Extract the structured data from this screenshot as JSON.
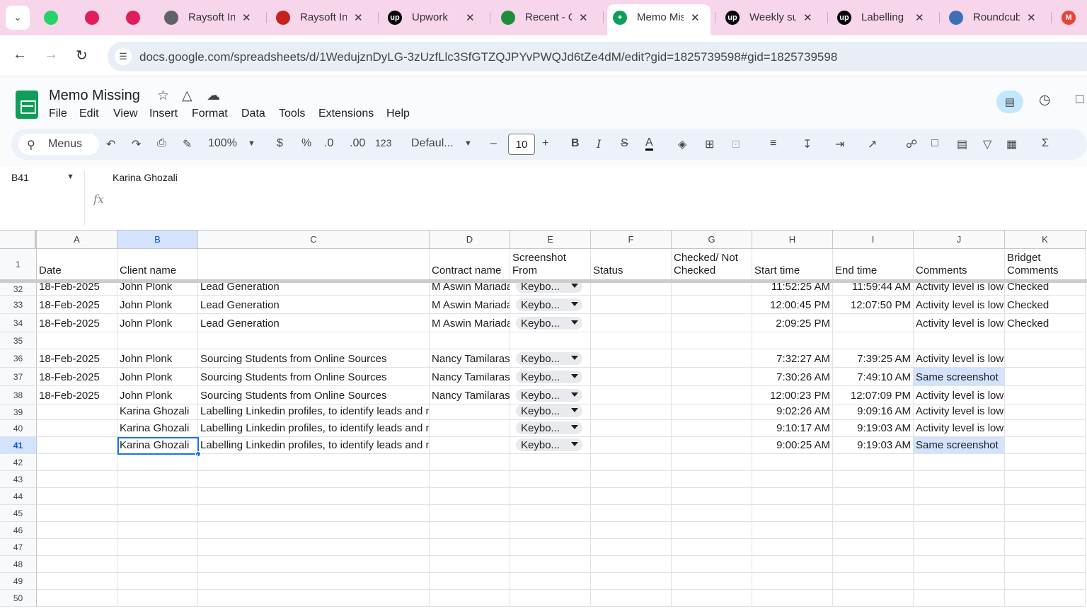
{
  "browser": {
    "tabs": [
      {
        "label": "",
        "icon": "whatsapp-icon",
        "color": "#25d366"
      },
      {
        "label": "",
        "icon": "slack-icon",
        "color": "#e01e5a"
      },
      {
        "label": "",
        "icon": "slack-icon",
        "color": "#e01e5a"
      },
      {
        "label": "Raysoft Inf",
        "icon": "globe-icon",
        "color": "#5f6368"
      },
      {
        "label": "Raysoft Inf",
        "icon": "raysoft-icon",
        "color": "#c5221f"
      },
      {
        "label": "Upwork",
        "icon": "upwork-icon",
        "color": "#000000"
      },
      {
        "label": "Recent - G",
        "icon": "drive-icon",
        "color": "#1e8e3e"
      },
      {
        "label": "Memo Mis",
        "icon": "sheets-icon",
        "color": "#0f9d58"
      },
      {
        "label": "Weekly su",
        "icon": "upwork-icon",
        "color": "#000000"
      },
      {
        "label": "Labelling",
        "icon": "upwork-icon",
        "color": "#000000"
      },
      {
        "label": "Roundcub",
        "icon": "roundcube-icon",
        "color": "#3c6fb6"
      },
      {
        "label": "",
        "icon": "gmail-icon",
        "color": "#ea4335"
      }
    ],
    "url": "docs.google.com/spreadsheets/d/1WedujznDyLG-3zUzfLlc3SfGTZQJPYvPWQJd6tZe4dM/edit?gid=1825739598#gid=1825739598"
  },
  "doc": {
    "title": "Memo Missing",
    "menu": [
      "File",
      "Edit",
      "View",
      "Insert",
      "Format",
      "Data",
      "Tools",
      "Extensions",
      "Help"
    ]
  },
  "toolbar": {
    "menus_label": "Menus",
    "zoom": "100%",
    "currency": "$",
    "percent": "%",
    "dec_decrease": ".0",
    "dec_increase": ".00",
    "number_format": "123",
    "font": "Defaul...",
    "font_size": "10"
  },
  "formula_bar": {
    "name_box": "B41",
    "fx": "fx",
    "value": "Karina Ghozali"
  },
  "sheet": {
    "columns": [
      "A",
      "B",
      "C",
      "D",
      "E",
      "F",
      "G",
      "H",
      "I",
      "J",
      "K"
    ],
    "selected_column": "B",
    "header_row": {
      "num": "1",
      "cells": [
        "Date",
        "Client name",
        "",
        "Contract name",
        "Screenshot From",
        "Status",
        "Checked/ Not Checked",
        "Start time",
        "End time",
        "Comments",
        "Bridget Comments"
      ]
    },
    "rows": [
      {
        "num": "32",
        "date": "18-Feb-2025",
        "client": "John Plonk",
        "contract": "Lead Generation",
        "freelancer": "M Aswin Mariadass",
        "chip": "Keybo...",
        "start": "11:52:25 AM",
        "end": "11:59:44 AM",
        "comment": "Activity level is low",
        "bridget": "Checked",
        "hl": false
      },
      {
        "num": "33",
        "date": "18-Feb-2025",
        "client": "John Plonk",
        "contract": "Lead Generation",
        "freelancer": "M Aswin Mariadass",
        "chip": "Keybo...",
        "start": "12:00:45 PM",
        "end": "12:07:50 PM",
        "comment": "Activity level is low",
        "bridget": "Checked",
        "hl": false
      },
      {
        "num": "34",
        "date": "18-Feb-2025",
        "client": "John Plonk",
        "contract": "Lead Generation",
        "freelancer": "M Aswin Mariadass",
        "chip": "Keybo...",
        "start": "2:09:25 PM",
        "end": "",
        "comment": "Activity level is low",
        "bridget": "Checked",
        "hl": false
      },
      {
        "num": "35",
        "date": "",
        "client": "",
        "contract": "",
        "freelancer": "",
        "chip": "",
        "start": "",
        "end": "",
        "comment": "",
        "bridget": "",
        "hl": false
      },
      {
        "num": "36",
        "date": "18-Feb-2025",
        "client": "John Plonk",
        "contract": "Sourcing Students from Online Sources",
        "freelancer": "Nancy Tamilarasi",
        "chip": "Keybo...",
        "start": "7:32:27 AM",
        "end": "7:39:25 AM",
        "comment": "Activity level is low",
        "bridget": "",
        "hl": false
      },
      {
        "num": "37",
        "date": "18-Feb-2025",
        "client": "John Plonk",
        "contract": "Sourcing Students from Online Sources",
        "freelancer": "Nancy Tamilarasi",
        "chip": "Keybo...",
        "start": "7:30:26 AM",
        "end": "7:49:10 AM",
        "comment": "Same screenshot",
        "bridget": "",
        "hl": true
      },
      {
        "num": "38",
        "date": "18-Feb-2025",
        "client": "John Plonk",
        "contract": "Sourcing Students from Online Sources",
        "freelancer": "Nancy Tamilarasi",
        "chip": "Keybo...",
        "start": "12:00:23 PM",
        "end": "12:07:09 PM",
        "comment": "Activity level is low",
        "bridget": "",
        "hl": false
      },
      {
        "num": "39",
        "date": "",
        "client": "Karina Ghozali",
        "contract": "Labelling Linkedin profiles, to identify leads and nurture an artificial",
        "freelancer": "",
        "chip": "Keybo...",
        "start": "9:02:26 AM",
        "end": "9:09:16 AM",
        "comment": "Activity level is low",
        "bridget": "",
        "hl": false
      },
      {
        "num": "40",
        "date": "",
        "client": "Karina Ghozali",
        "contract": "Labelling Linkedin profiles, to identify leads and nurture an artificial",
        "freelancer": "",
        "chip": "Keybo...",
        "start": "9:10:17 AM",
        "end": "9:19:03 AM",
        "comment": "Activity level is low",
        "bridget": "",
        "hl": false
      },
      {
        "num": "41",
        "date": "",
        "client": "Karina Ghozali",
        "contract": "Labelling Linkedin profiles, to identify leads and nurture an artificial",
        "freelancer": "",
        "chip": "Keybo...",
        "start": "9:00:25 AM",
        "end": "9:19:03 AM",
        "comment": "Same screenshot",
        "bridget": "",
        "hl": true
      },
      {
        "num": "42"
      },
      {
        "num": "43"
      },
      {
        "num": "44"
      },
      {
        "num": "45"
      },
      {
        "num": "46"
      },
      {
        "num": "47"
      },
      {
        "num": "48"
      },
      {
        "num": "49"
      },
      {
        "num": "50"
      }
    ]
  }
}
